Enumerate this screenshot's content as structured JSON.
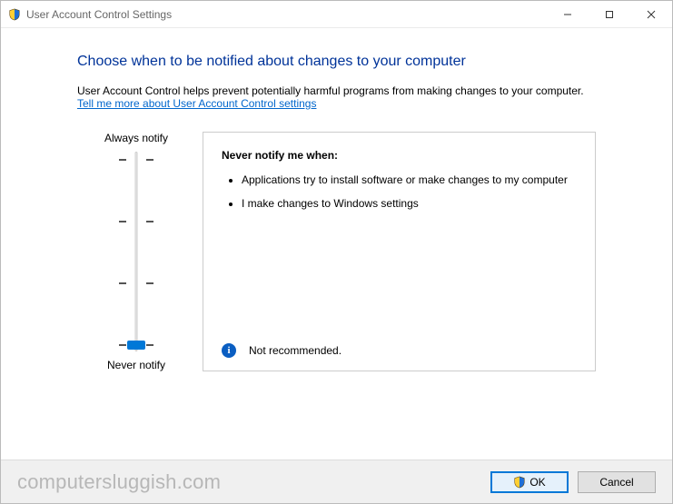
{
  "window": {
    "title": "User Account Control Settings"
  },
  "page": {
    "heading": "Choose when to be notified about changes to your computer",
    "description": "User Account Control helps prevent potentially harmful programs from making changes to your computer.",
    "link": "Tell me more about User Account Control settings"
  },
  "slider": {
    "top_label": "Always notify",
    "bottom_label": "Never notify",
    "levels": 4,
    "selected_index": 3
  },
  "panel": {
    "title": "Never notify me when:",
    "items": [
      "Applications try to install software or make changes to my computer",
      "I make changes to Windows settings"
    ],
    "note": "Not recommended."
  },
  "buttons": {
    "ok": "OK",
    "cancel": "Cancel"
  },
  "watermark": "computersluggish.com"
}
